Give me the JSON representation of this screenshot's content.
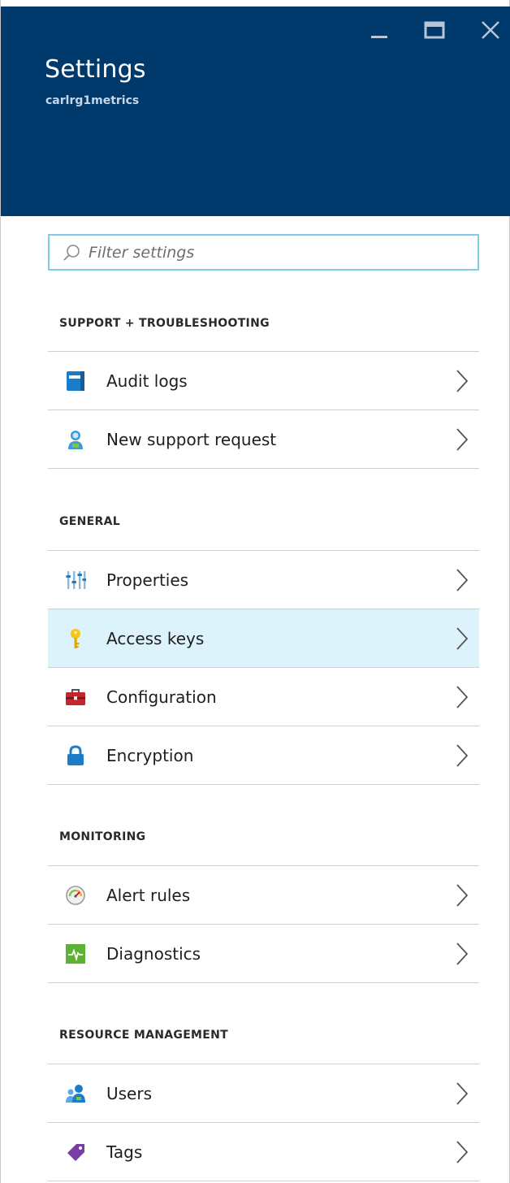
{
  "header": {
    "title": "Settings",
    "subtitle": "carlrg1metrics",
    "background": "#003a6c"
  },
  "filter": {
    "placeholder": "Filter settings",
    "value": ""
  },
  "sections": [
    {
      "header": "SUPPORT + TROUBLESHOOTING",
      "items": [
        {
          "label": "Audit logs",
          "icon": "audit-logs-icon"
        },
        {
          "label": "New support request",
          "icon": "support-request-icon"
        }
      ]
    },
    {
      "header": "GENERAL",
      "items": [
        {
          "label": "Properties",
          "icon": "properties-icon"
        },
        {
          "label": "Access keys",
          "icon": "key-icon",
          "selected": true
        },
        {
          "label": "Configuration",
          "icon": "toolbox-icon"
        },
        {
          "label": "Encryption",
          "icon": "lock-icon"
        }
      ]
    },
    {
      "header": "MONITORING",
      "items": [
        {
          "label": "Alert rules",
          "icon": "gauge-icon"
        },
        {
          "label": "Diagnostics",
          "icon": "diagnostics-icon"
        }
      ]
    },
    {
      "header": "RESOURCE MANAGEMENT",
      "items": [
        {
          "label": "Users",
          "icon": "users-icon"
        },
        {
          "label": "Tags",
          "icon": "tag-icon"
        }
      ]
    }
  ],
  "colors": {
    "selected_row": "#dcf3fb",
    "filter_border": "#7fcbe8"
  }
}
